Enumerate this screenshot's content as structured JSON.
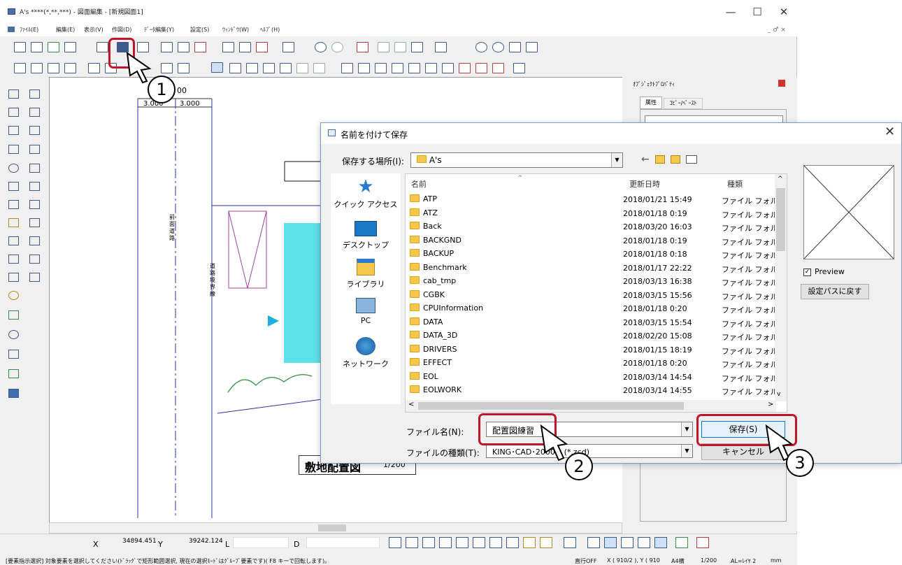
{
  "app": {
    "title": "A's ****(*,**,***) - 図面編集 - [新規図面1]",
    "menu": [
      "ﾌｧｲﾙ(E)",
      "編集(E)",
      "表示(V)",
      "作図(D)",
      "ﾃﾞｰﾀ編集(Y)",
      "設定(S)",
      "ｳｨﾝﾄﾞｳ(W)",
      "ﾍﾙﾌﾟ(H)"
    ],
    "window_controls": {
      "minimize": "—",
      "maximize": "☐",
      "close": "✕"
    },
    "mdi_controls": "_ ♂ ×"
  },
  "canvas": {
    "dim_top": "00",
    "dim_left": "3.000",
    "dim_right": "3.000",
    "road_label": "前面道路",
    "boundary_label": "道路境界線",
    "site_label": "敷地配置図",
    "site_scale": "1/200"
  },
  "right_panel": {
    "title": "ｵﾌﾞｼﾞｪｸﾄﾌﾟﾛﾊﾟﾃｨ",
    "tab_attr": "属性",
    "tab_copy": "ｺﾋﾟｰ/ﾍﾟｰｽﾄ"
  },
  "statusbar": {
    "x_label": "X",
    "x_value": "34894.451",
    "y_label": "Y",
    "y_value": "39242.124",
    "l_label": "L",
    "d_label": "D",
    "message": "[要素指示選択]  対象要素を選択してください(ﾄﾞﾗｯｸﾞで矩形範囲選択, 現在の選択ﾓｰﾄﾞはｸﾞﾙｰﾌﾟ要素です)( F8 キーで回転します)。",
    "ortho": "直行OFF",
    "coords": "X ( 910/2 ), Y ( 910",
    "paper": "A4横",
    "scale": "1/200",
    "layer": "AL=ﾚｲﾔ 2",
    "unit": "mm"
  },
  "dialog": {
    "title": "名前を付けて保存",
    "location_label": "保存する場所(I):",
    "location_value": "A's",
    "places": [
      "クイック アクセス",
      "デスクトップ",
      "ライブラリ",
      "PC",
      "ネットワーク"
    ],
    "columns": [
      "名前",
      "更新日時",
      "種類"
    ],
    "files": [
      {
        "name": "ATP",
        "date": "2018/01/21 15:49",
        "type": "ファイル フォル"
      },
      {
        "name": "ATZ",
        "date": "2018/01/18 0:19",
        "type": "ファイル フォル"
      },
      {
        "name": "Back",
        "date": "2018/03/20 16:03",
        "type": "ファイル フォル"
      },
      {
        "name": "BACKGND",
        "date": "2018/01/18 0:19",
        "type": "ファイル フォル"
      },
      {
        "name": "BACKUP",
        "date": "2018/01/18 0:18",
        "type": "ファイル フォル"
      },
      {
        "name": "Benchmark",
        "date": "2018/01/17 22:22",
        "type": "ファイル フォル"
      },
      {
        "name": "cab_tmp",
        "date": "2018/03/13 16:38",
        "type": "ファイル フォル"
      },
      {
        "name": "CGBK",
        "date": "2018/03/15 15:56",
        "type": "ファイル フォル"
      },
      {
        "name": "CPUInformation",
        "date": "2018/01/18 0:20",
        "type": "ファイル フォル"
      },
      {
        "name": "DATA",
        "date": "2018/03/15 15:54",
        "type": "ファイル フォル"
      },
      {
        "name": "DATA_3D",
        "date": "2018/02/20 15:08",
        "type": "ファイル フォル"
      },
      {
        "name": "DRIVERS",
        "date": "2018/01/15 18:19",
        "type": "ファイル フォル"
      },
      {
        "name": "EFFECT",
        "date": "2018/01/18 0:20",
        "type": "ファイル フォル"
      },
      {
        "name": "EOL",
        "date": "2018/03/14 14:54",
        "type": "ファイル フォル"
      },
      {
        "name": "EOLWORK",
        "date": "2018/03/14 14:55",
        "type": "ファイル フォル"
      }
    ],
    "filename_label": "ファイル名(N):",
    "filename_value": "配置図練習",
    "filetype_label": "ファイルの種類(T):",
    "filetype_value": "KING･CAD･2000 s (*.zcd)",
    "save_button": "保存(S)",
    "cancel_button": "キャンセル",
    "preview_label": "Preview",
    "preview_checked": true,
    "reset_path_button": "設定パスに戻す"
  },
  "callouts": [
    "1",
    "2",
    "3"
  ]
}
